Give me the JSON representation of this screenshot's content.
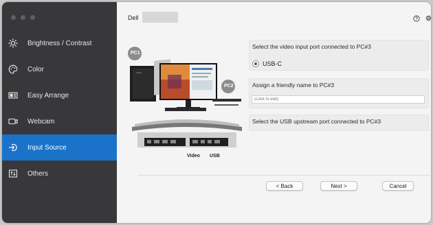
{
  "app": {
    "title": "Dell"
  },
  "sidebar": {
    "items": [
      {
        "label": "Brightness / Contrast",
        "icon": "brightness-icon",
        "active": false
      },
      {
        "label": "Color",
        "icon": "palette-icon",
        "active": false
      },
      {
        "label": "Easy Arrange",
        "icon": "easy-arrange-icon",
        "active": false
      },
      {
        "label": "Webcam",
        "icon": "webcam-icon",
        "active": false
      },
      {
        "label": "Input Source",
        "icon": "input-source-icon",
        "active": true
      },
      {
        "label": "Others",
        "icon": "others-icon",
        "active": false
      }
    ]
  },
  "illustration": {
    "pc1_label": "PC1",
    "pc2_label": "PC2",
    "port_video_label": "Video",
    "port_usb_label": "USB"
  },
  "input_port": {
    "prompt": "Select the video input port connected to PC#3",
    "selected": "USB-C"
  },
  "friendly_name": {
    "prompt": "Assign a friendly name to PC#3",
    "placeholder": "(Click to edit)"
  },
  "usb_upstream": {
    "prompt": "Select the USB upstream port connected to PC#3"
  },
  "footer": {
    "back": "< Back",
    "next": "Next >",
    "cancel": "Cancel"
  },
  "colors": {
    "sidebar_bg": "#38383b",
    "active_item": "#1a73c9",
    "content_bg": "#f4f4f4"
  }
}
